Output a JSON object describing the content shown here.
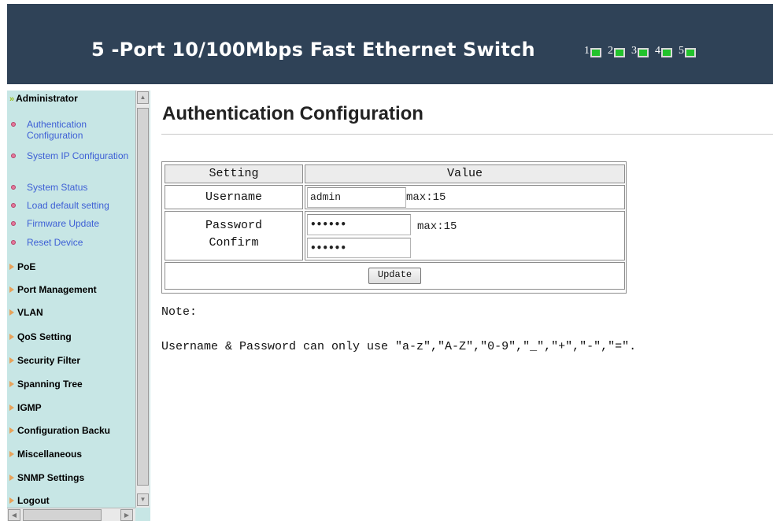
{
  "header": {
    "title": "5 -Port 10/100Mbps  Fast Ethernet Switch",
    "ports": [
      "1",
      "2",
      "3",
      "4",
      "5"
    ],
    "port_led_color": "#22c22c",
    "background": "#2f4257"
  },
  "sidebar": {
    "background": "#c7e6e5",
    "administrator": "Administrator",
    "admin_items": [
      "Authentication Configuration",
      "System IP Configuration",
      "System Status",
      "Load default setting",
      "Firmware Update",
      "Reset Device"
    ],
    "groups": [
      "PoE",
      "Port Management",
      "VLAN",
      "QoS Setting",
      "Security Filter",
      "Spanning Tree",
      "IGMP",
      "Configuration Backu",
      "Miscellaneous",
      "SNMP Settings",
      "Logout"
    ]
  },
  "main": {
    "title": "Authentication Configuration",
    "table": {
      "col_setting": "Setting",
      "col_value": "Value",
      "username_label": "Username",
      "username_value": "admin",
      "username_max": "max:15",
      "password_label": "Password",
      "confirm_label": "Confirm",
      "password_value": "••••••",
      "confirm_value": "••••••",
      "password_max": "max:15",
      "update_button": "Update"
    },
    "note_label": "Note:",
    "note_text": "Username & Password can only use ″a-z″,″A-Z″,″0-9″,″_″,″+″,″-″,″=″."
  }
}
